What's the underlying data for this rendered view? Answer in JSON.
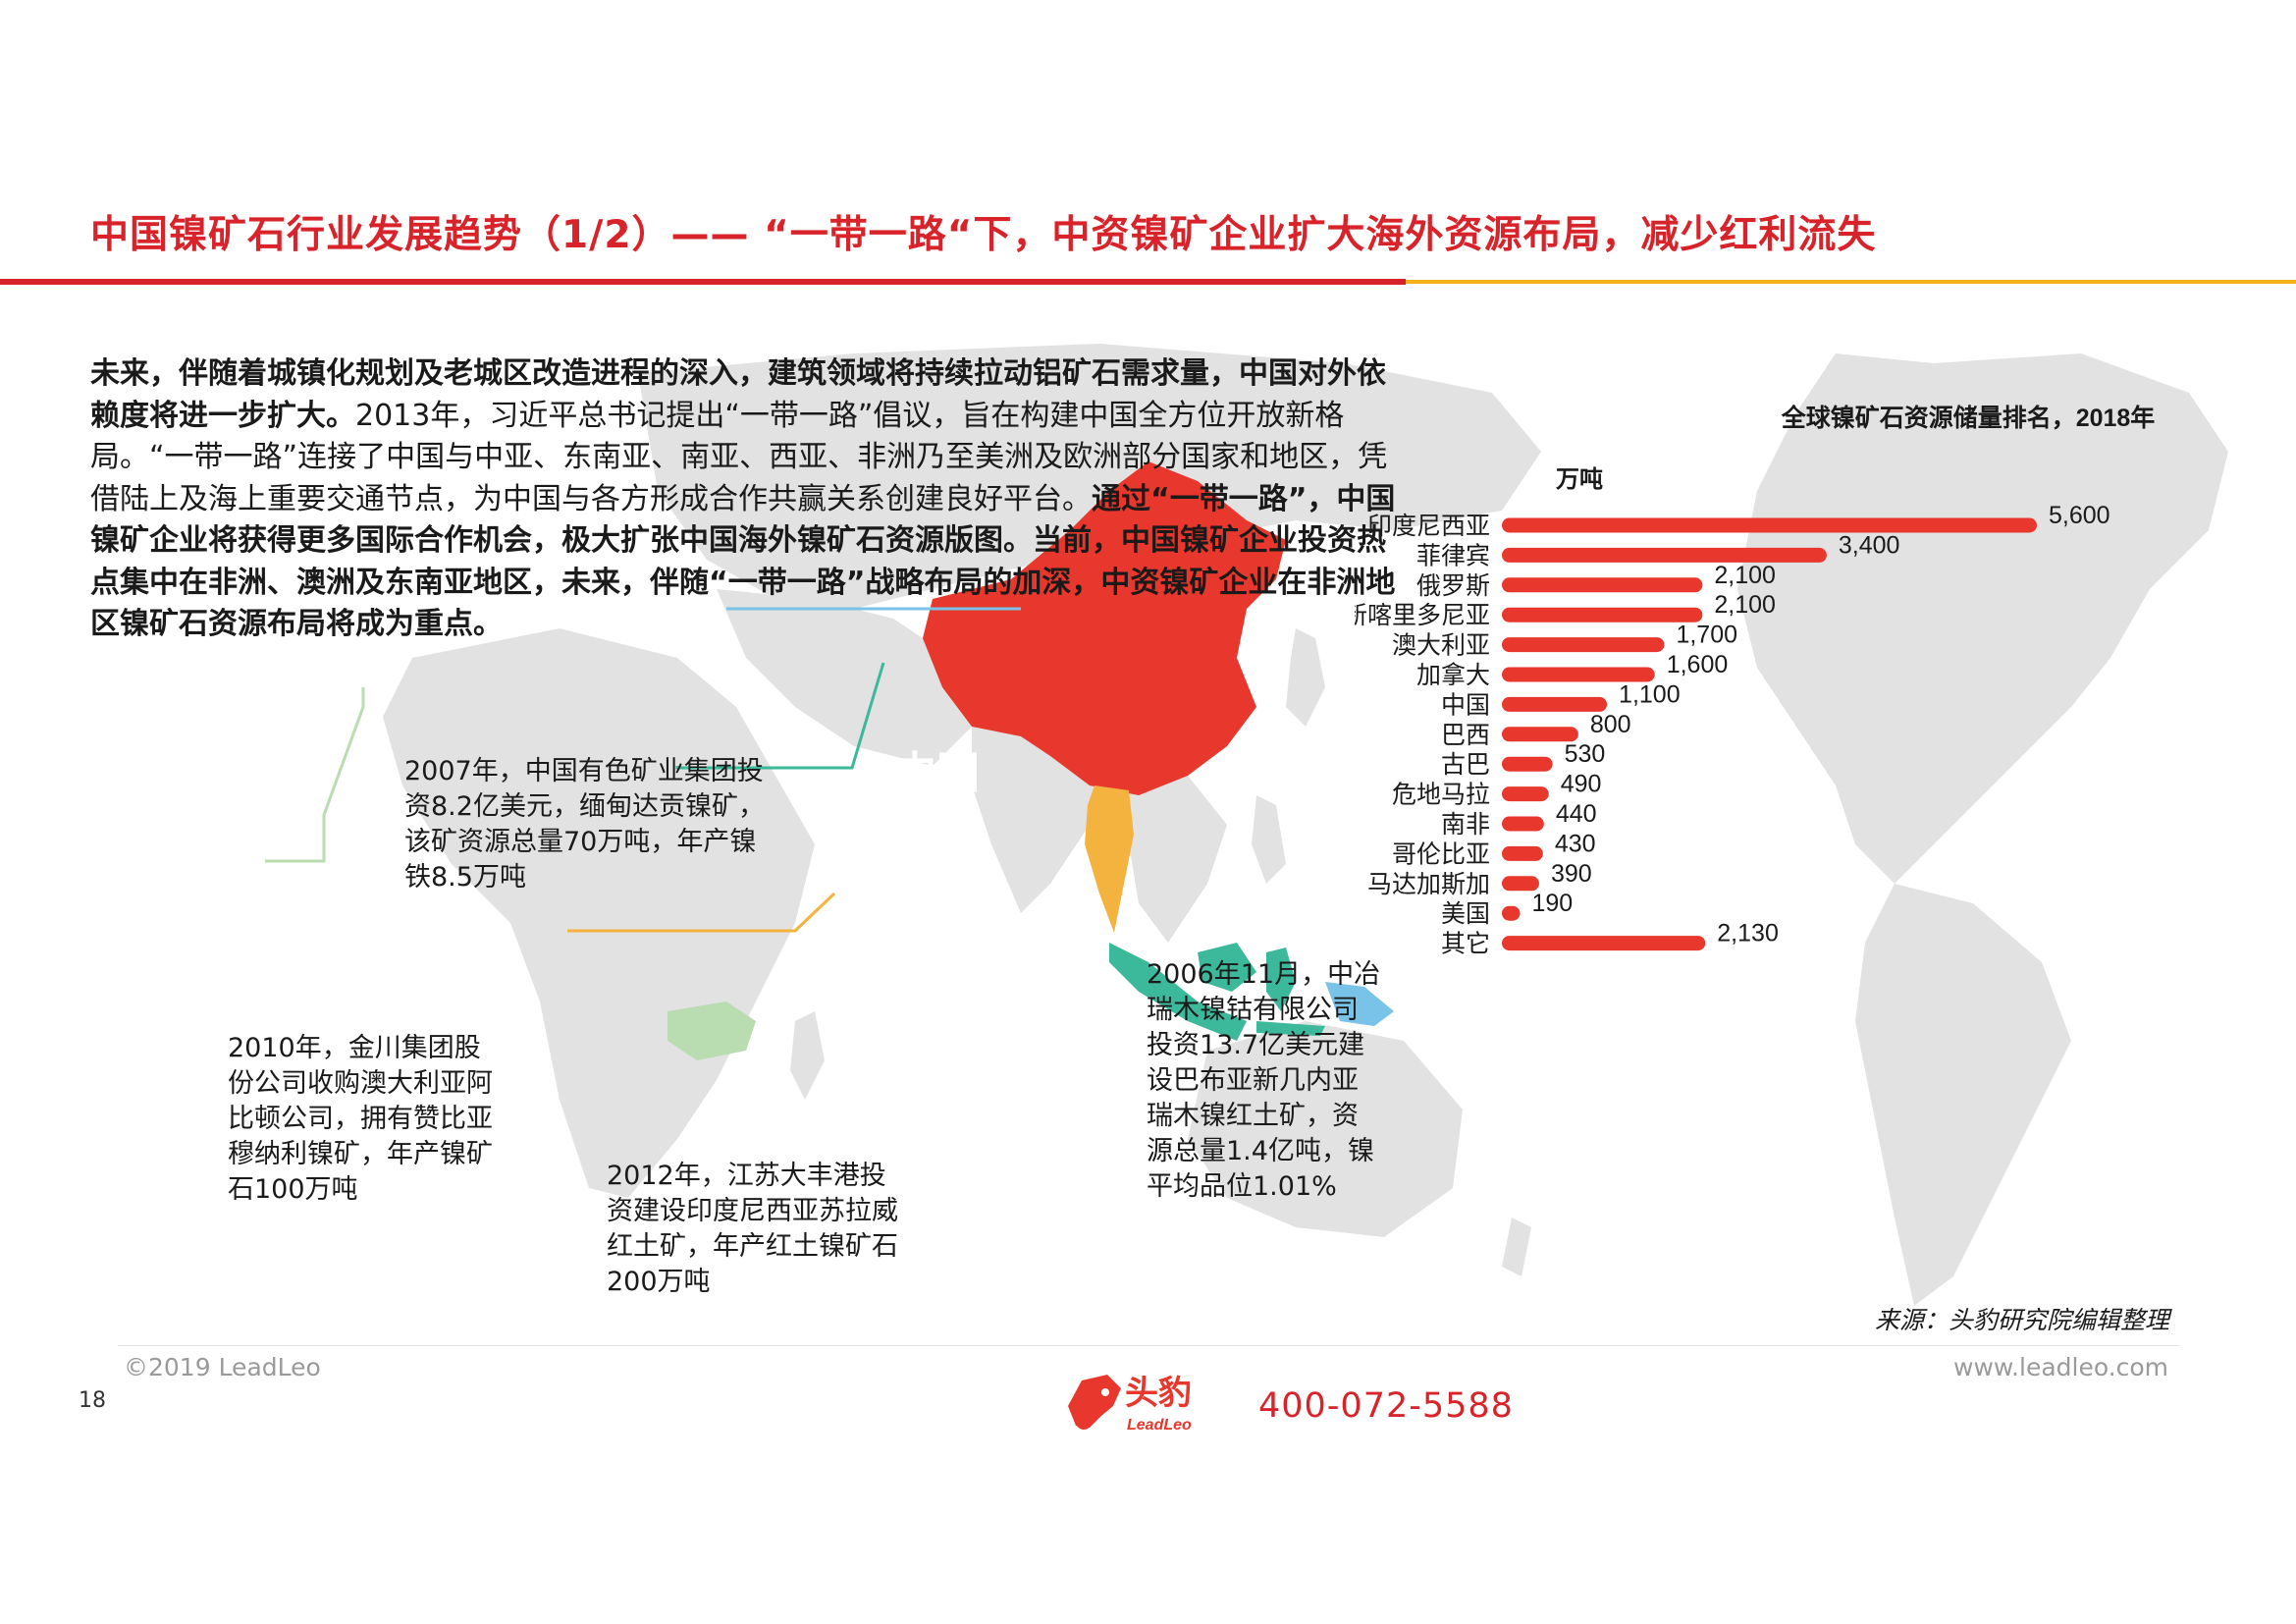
{
  "header": {
    "title": "中国镍矿石行业发展趋势（1/2）—— “一带一路“下，中资镍矿企业扩大海外资源布局，减少红利流失"
  },
  "intro": {
    "bold_1": "未来，伴随着城镇化规划及老城区改造进程的深入，建筑领域将持续拉动铝矿石需求量，中国对外依赖度将进一步扩大。",
    "normal_1": "2013年，习近平总书记提出“一带一路”倡议，旨在构建中国全方位开放新格局。“一带一路”连接了中国与中亚、东南亚、南亚、西亚、非洲乃至美洲及欧洲部分国家和地区，凭借陆上及海上重要交通节点，为中国与各方形成合作共赢关系创建良好平台。",
    "bold_2": "通过“一带一路”，中国镍矿企业将获得更多国际合作机会，极大扩张中国海外镍矿石资源版图。当前，中国镍矿企业投资热点集中在非洲、澳洲及东南亚地区，未来，伴随“一带一路”战略布局的加深，中资镍矿企业在非洲地区镍矿石资源布局将成为重点。"
  },
  "map": {
    "china_label": "中国",
    "colors": {
      "land": "#e2e2e2",
      "china": "#e8372c",
      "myanmar": "#f4b23e",
      "indonesia": "#3cb89a",
      "png": "#7ac3e8",
      "zambia": "#b9dcb0"
    }
  },
  "callouts": {
    "c2007": "2007年，中国有色矿业集团投资8.2亿美元，缅甸达贡镍矿，该矿资源总量70万吨，年产镍铁8.5万吨",
    "c2010": "2010年，金川集团股份公司收购澳大利亚阿比顿公司，拥有赞比亚穆纳利镍矿，年产镍矿石100万吨",
    "c2012": "2012年，江苏大丰港投资建设印度尼西亚苏拉威红土矿，年产红土镍矿石200万吨",
    "c2006": "2006年11月，中冶瑞木镍钴有限公司投资13.7亿美元建设巴布亚新几内亚瑞木镍红土矿，资源总量1.4亿吨，镍平均品位1.01%"
  },
  "chart_data": {
    "type": "bar",
    "orientation": "horizontal",
    "title": "全球镍矿石资源储量排名，2018年",
    "unit_label": "万吨",
    "categories": [
      "印度尼西亚",
      "菲律宾",
      "俄罗斯",
      "新喀里多尼亚",
      "澳大利亚",
      "加拿大",
      "中国",
      "巴西",
      "古巴",
      "危地马拉",
      "南非",
      "哥伦比亚",
      "马达加斯加",
      "美国",
      "其它"
    ],
    "values": [
      5600,
      3400,
      2100,
      2100,
      1700,
      1600,
      1100,
      800,
      530,
      490,
      440,
      430,
      390,
      190,
      2130
    ],
    "value_labels": [
      "5,600",
      "3,400",
      "2,100",
      "2,100",
      "1,700",
      "1,600",
      "1,100",
      "800",
      "530",
      "490",
      "440",
      "430",
      "390",
      "190",
      "2,130"
    ],
    "bar_color": "#e8372c",
    "grid": false,
    "legend": "none"
  },
  "source": "来源：头豹研究院编辑整理",
  "footer": {
    "copyright": "©2019 LeadLeo",
    "website": "www.leadleo.com",
    "page_number": "18",
    "logo_text": "头豹",
    "logo_subtext": "LeadLeo",
    "phone": "400-072-5588"
  }
}
